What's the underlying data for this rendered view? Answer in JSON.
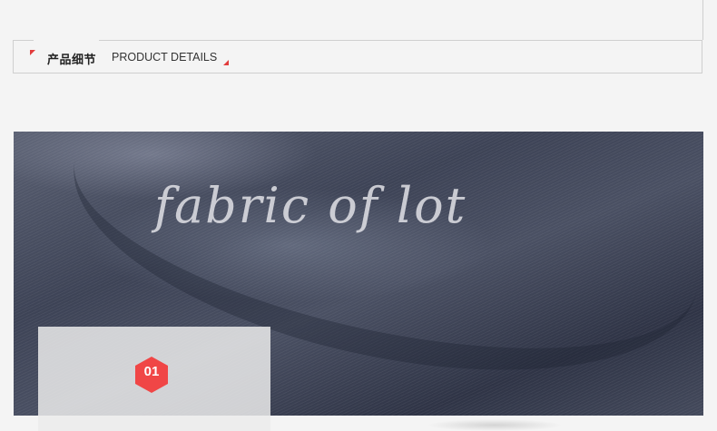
{
  "section": {
    "title_cn": "产品细节",
    "title_en": "PRODUCT DETAILS",
    "accent_color": "#e23c3c"
  },
  "hero": {
    "caption": "fabric of lot",
    "badge_number": "01",
    "badge_color": "#f04646"
  }
}
